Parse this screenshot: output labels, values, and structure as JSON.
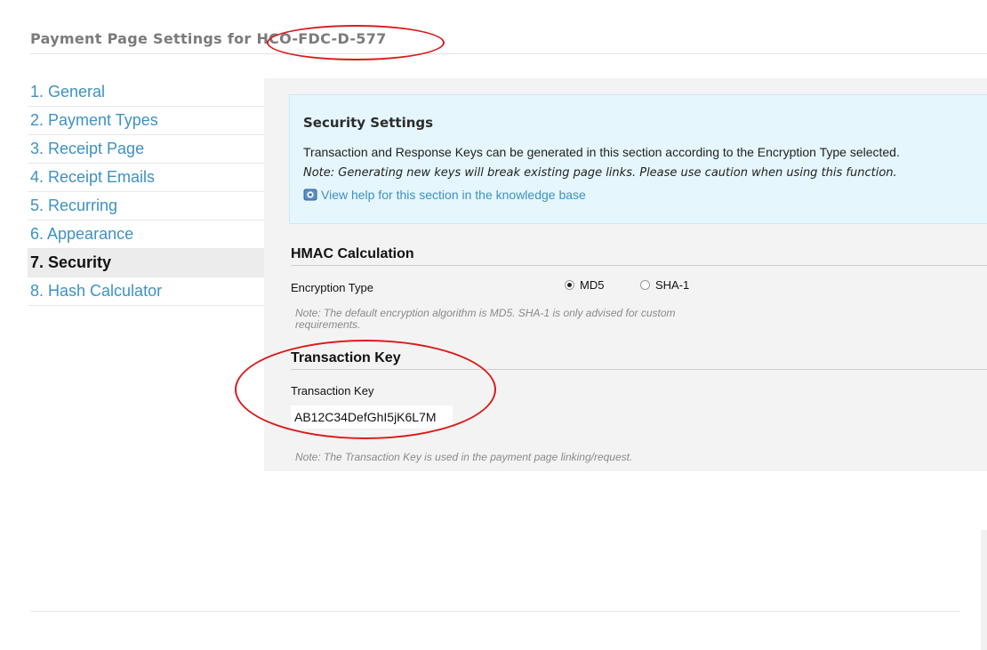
{
  "page_title": "Payment Page Settings for HCO-FDC-D-577",
  "sidebar": {
    "items": [
      {
        "label": "1. General",
        "active": false
      },
      {
        "label": "2. Payment Types",
        "active": false
      },
      {
        "label": "3. Receipt Page",
        "active": false
      },
      {
        "label": "4. Receipt Emails",
        "active": false
      },
      {
        "label": "5. Recurring",
        "active": false
      },
      {
        "label": "6. Appearance",
        "active": false
      },
      {
        "label": "7. Security",
        "active": true
      },
      {
        "label": "8. Hash Calculator",
        "active": false
      }
    ]
  },
  "security_settings": {
    "title": "Security Settings",
    "description": "Transaction and Response Keys can be generated in this section according to the Encryption Type selected.",
    "note": "Note: Generating new keys will break existing page links. Please use caution when using this function.",
    "help_link": "View help for this section in the knowledge base",
    "help_icon": "knowledge-base-icon"
  },
  "hmac": {
    "heading": "HMAC Calculation",
    "encryption_label": "Encryption Type",
    "options": [
      {
        "label": "MD5",
        "selected": true
      },
      {
        "label": "SHA-1",
        "selected": false
      }
    ],
    "note_line1": "Note: The default encryption algorithm is MD5. SHA-1 is only advised for custom",
    "note_line2": "requirements."
  },
  "transaction_key": {
    "heading": "Transaction Key",
    "label": "Transaction Key",
    "value": "AB12C34DefGhI5jK6L7M",
    "note": "Note: The Transaction Key is used in the payment page linking/request."
  },
  "colors": {
    "link": "#3e91c4",
    "highlight": "#d91c1c",
    "info_box_bg": "#e5f6fc"
  }
}
